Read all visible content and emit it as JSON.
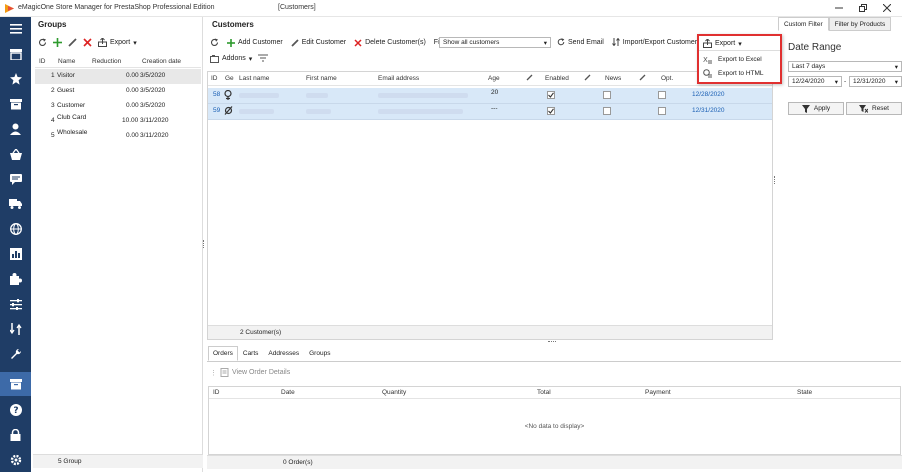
{
  "window": {
    "title": "eMagicOne Store Manager for PrestaShop Professional Edition",
    "document": "[Customers]"
  },
  "colors": {
    "nav_bg": "#1f3d66",
    "nav_active": "#3d6aa8",
    "highlight": "#e03030",
    "row_selected": "#d8e8f8",
    "link": "#1a5fb4"
  },
  "nav": {
    "icons": [
      "menu-icon",
      "store-icon",
      "star-icon",
      "box-icon",
      "user-icon",
      "basket-icon",
      "chat-icon",
      "truck-icon",
      "globe-icon",
      "chart-icon",
      "puzzle-icon",
      "sliders-icon",
      "transfer-icon",
      "wrench-icon",
      "storage-icon",
      "help-icon",
      "lock-icon",
      "gear-icon"
    ]
  },
  "groups": {
    "title": "Groups",
    "toolbar": {
      "export_label": "Export"
    },
    "columns": [
      "ID",
      "Name",
      "Reduction",
      "Creation date"
    ],
    "rows": [
      {
        "id": "1",
        "name": "Visitor",
        "reduction": "0.00",
        "date": "3/5/2020"
      },
      {
        "id": "2",
        "name": "Guest",
        "reduction": "0.00",
        "date": "3/5/2020"
      },
      {
        "id": "3",
        "name": "Customer",
        "reduction": "0.00",
        "date": "3/5/2020"
      },
      {
        "id": "4",
        "name": "Club Card",
        "reduction": "10.00",
        "date": "3/11/2020"
      },
      {
        "id": "5",
        "name": "Wholesale",
        "reduction": "0.00",
        "date": "3/11/2020"
      }
    ],
    "footer": "5 Group"
  },
  "customers": {
    "title": "Customers",
    "toolbar": {
      "add": "Add Customer",
      "edit": "Edit Customer",
      "delete": "Delete Customer(s)",
      "filter_label": "Filter",
      "filter_value": "Show all customers",
      "send_email": "Send Email",
      "import_export": "Import/Export Customer",
      "export": "Export",
      "addons": "Addons"
    },
    "columns": [
      "ID",
      "Ge",
      "Last name",
      "First name",
      "Email address",
      "Age",
      "Enabled",
      "News",
      "Opt."
    ],
    "rows": [
      {
        "id": "58",
        "age": "20",
        "enabled": true,
        "news": false,
        "opt": false,
        "date": "12/28/2020"
      },
      {
        "id": "59",
        "age": "---",
        "enabled": true,
        "news": false,
        "opt": false,
        "date": "12/31/2020"
      }
    ],
    "footer": "2 Customer(s)"
  },
  "export_menu": {
    "items": [
      "Export to Excel",
      "Export to HTML"
    ]
  },
  "bottom": {
    "tabs": [
      "Orders",
      "Carts",
      "Addresses",
      "Groups"
    ],
    "view_details": "View Order Details",
    "columns": [
      "ID",
      "Date",
      "Quantity",
      "Total",
      "Payment",
      "State"
    ],
    "empty": "<No data to display>",
    "footer": "0 Order(s)"
  },
  "filter": {
    "tabs": [
      "Custom Filter",
      "Filter by Products"
    ],
    "title": "Date Range",
    "range": "Last 7 days",
    "date_from": "12/24/2020",
    "date_to": "12/31/2020",
    "apply": "Apply",
    "reset": "Reset"
  }
}
